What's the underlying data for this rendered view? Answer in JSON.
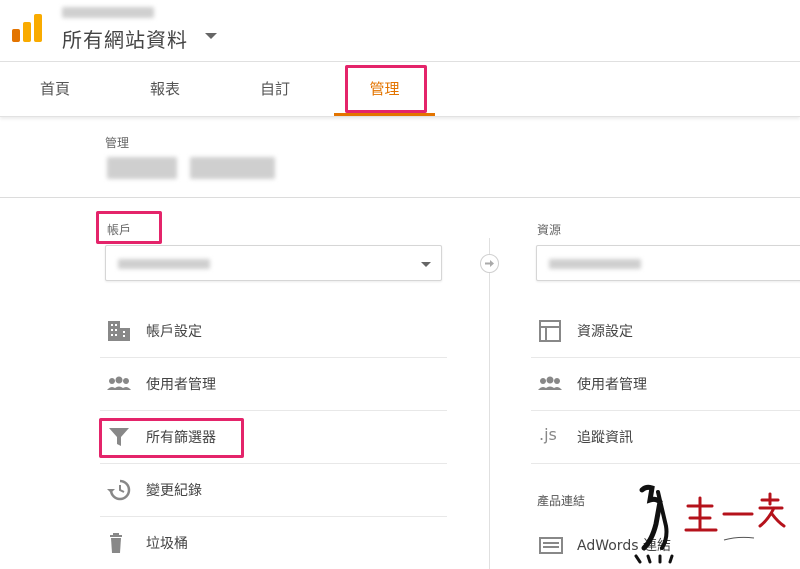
{
  "header": {
    "site_title": "所有網站資料",
    "logo_colors": {
      "bar_tall": "#f9ab00",
      "bar_short": "#e37400"
    }
  },
  "tabs": [
    {
      "label": "首頁"
    },
    {
      "label": "報表"
    },
    {
      "label": "自訂"
    },
    {
      "label": "管理"
    }
  ],
  "admin": {
    "label": "管理"
  },
  "account_column": {
    "label": "帳戶",
    "items": [
      {
        "label": "帳戶設定",
        "icon": "building-icon"
      },
      {
        "label": "使用者管理",
        "icon": "users-icon"
      },
      {
        "label": "所有篩選器",
        "icon": "filter-icon"
      },
      {
        "label": "變更紀錄",
        "icon": "history-icon"
      },
      {
        "label": "垃圾桶",
        "icon": "trash-icon"
      }
    ]
  },
  "property_column": {
    "label": "資源",
    "items": [
      {
        "label": "資源設定",
        "icon": "layout-icon"
      },
      {
        "label": "使用者管理",
        "icon": "users-icon"
      },
      {
        "label": "追蹤資訊",
        "icon": "js-icon",
        "icon_text": ".js"
      }
    ],
    "section_label": "產品連結",
    "linked": [
      {
        "label": "AdWords 連結",
        "icon": "adwords-icon"
      }
    ]
  },
  "colors": {
    "accent": "#e37400",
    "highlight": "#e4246a",
    "icon": "#888888"
  }
}
